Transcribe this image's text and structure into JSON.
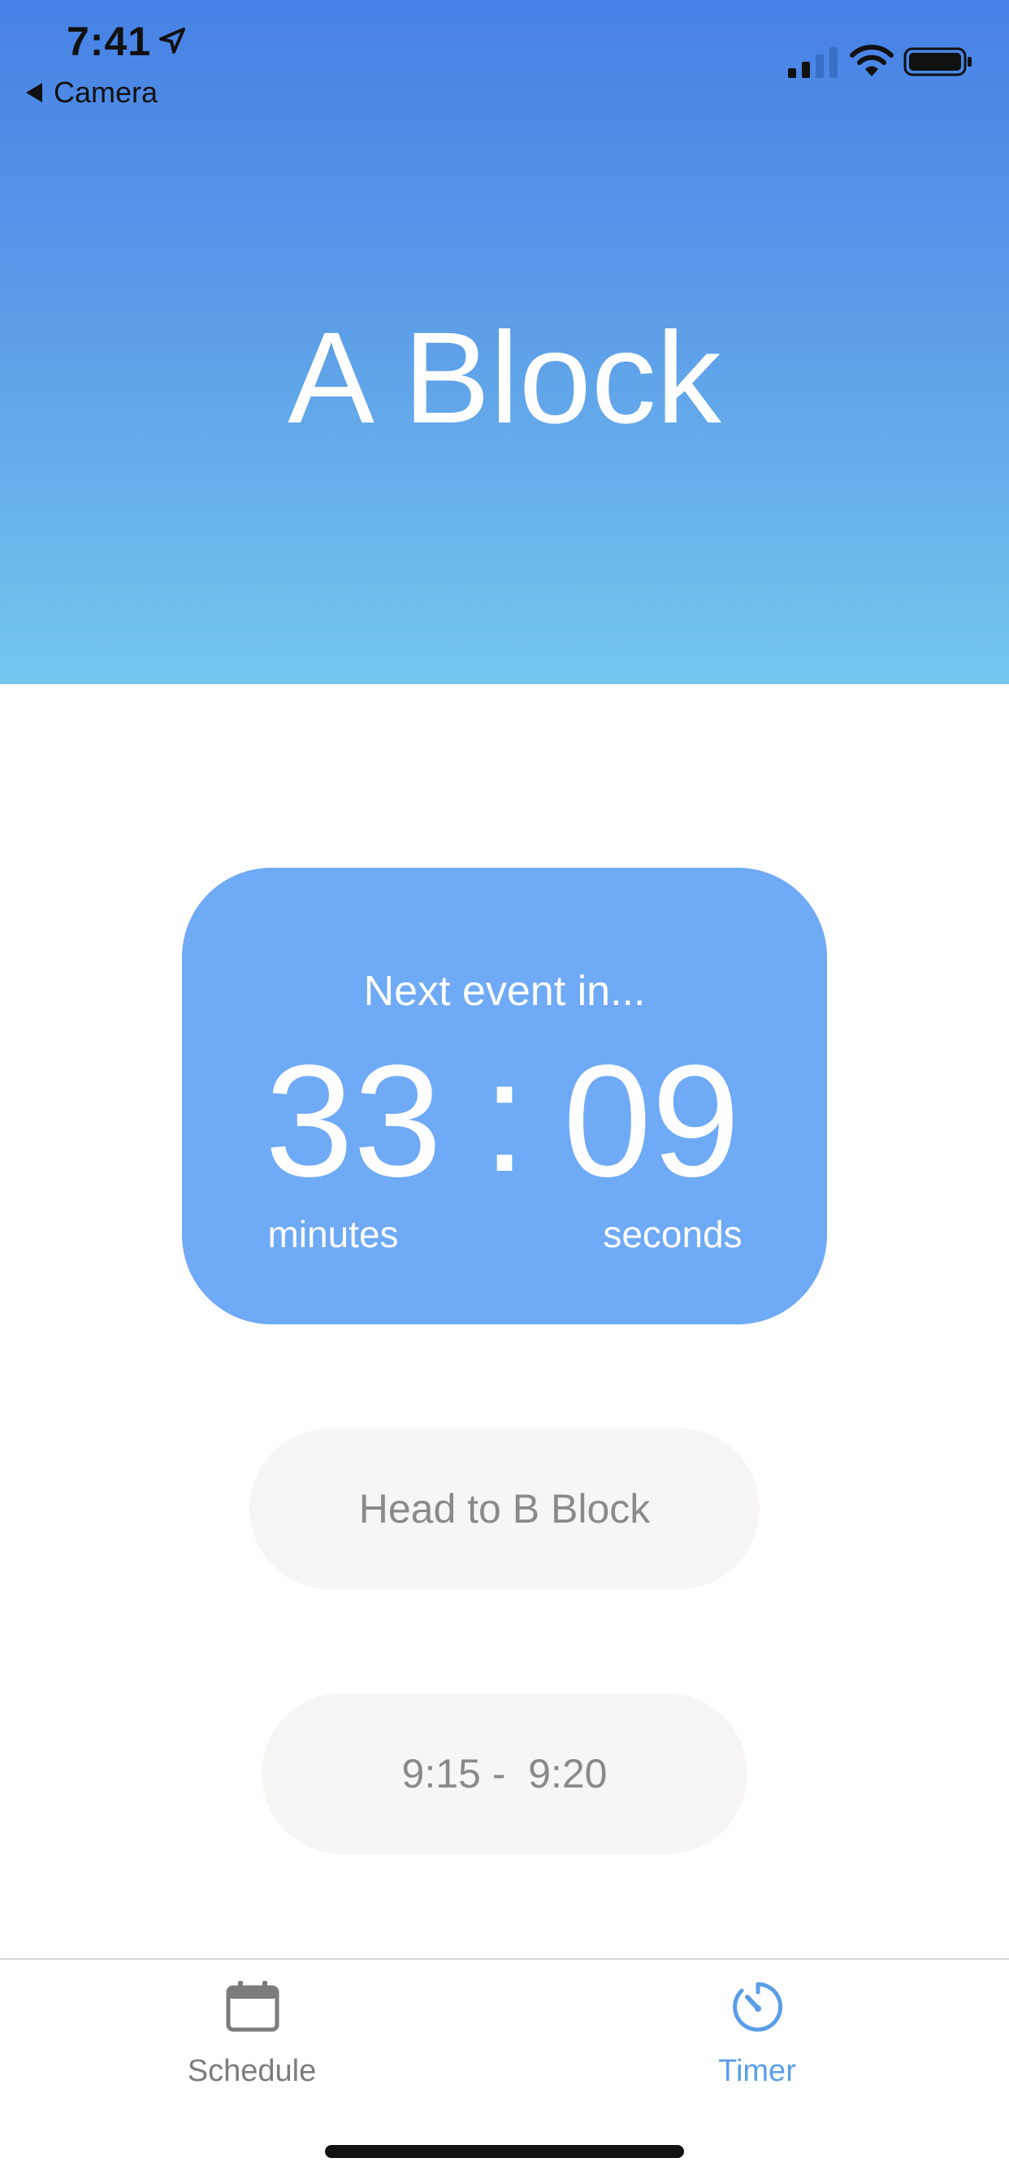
{
  "status_bar": {
    "time": "7:41",
    "back_label": "Camera",
    "icons": [
      "location-arrow-icon",
      "cellular-signal-icon",
      "wifi-icon",
      "battery-icon"
    ]
  },
  "header": {
    "title": "A Block",
    "gradient_top": "#4681e6",
    "gradient_bottom": "#74c6ee"
  },
  "timer": {
    "caption": "Next event in...",
    "minutes": "33",
    "separator": ":",
    "seconds": "09",
    "minutes_label": "minutes",
    "seconds_label": "seconds",
    "card_color": "#6eaaf6"
  },
  "next_event": {
    "label": "Head to B Block"
  },
  "time_range": {
    "label": "9:15 -  9:20"
  },
  "tab_bar": {
    "tabs": [
      {
        "label": "Schedule",
        "icon": "calendar-icon",
        "selected": false
      },
      {
        "label": "Timer",
        "icon": "timer-icon",
        "selected": true
      }
    ],
    "active_color": "#5a9ee8",
    "inactive_color": "#7c7c7c"
  }
}
